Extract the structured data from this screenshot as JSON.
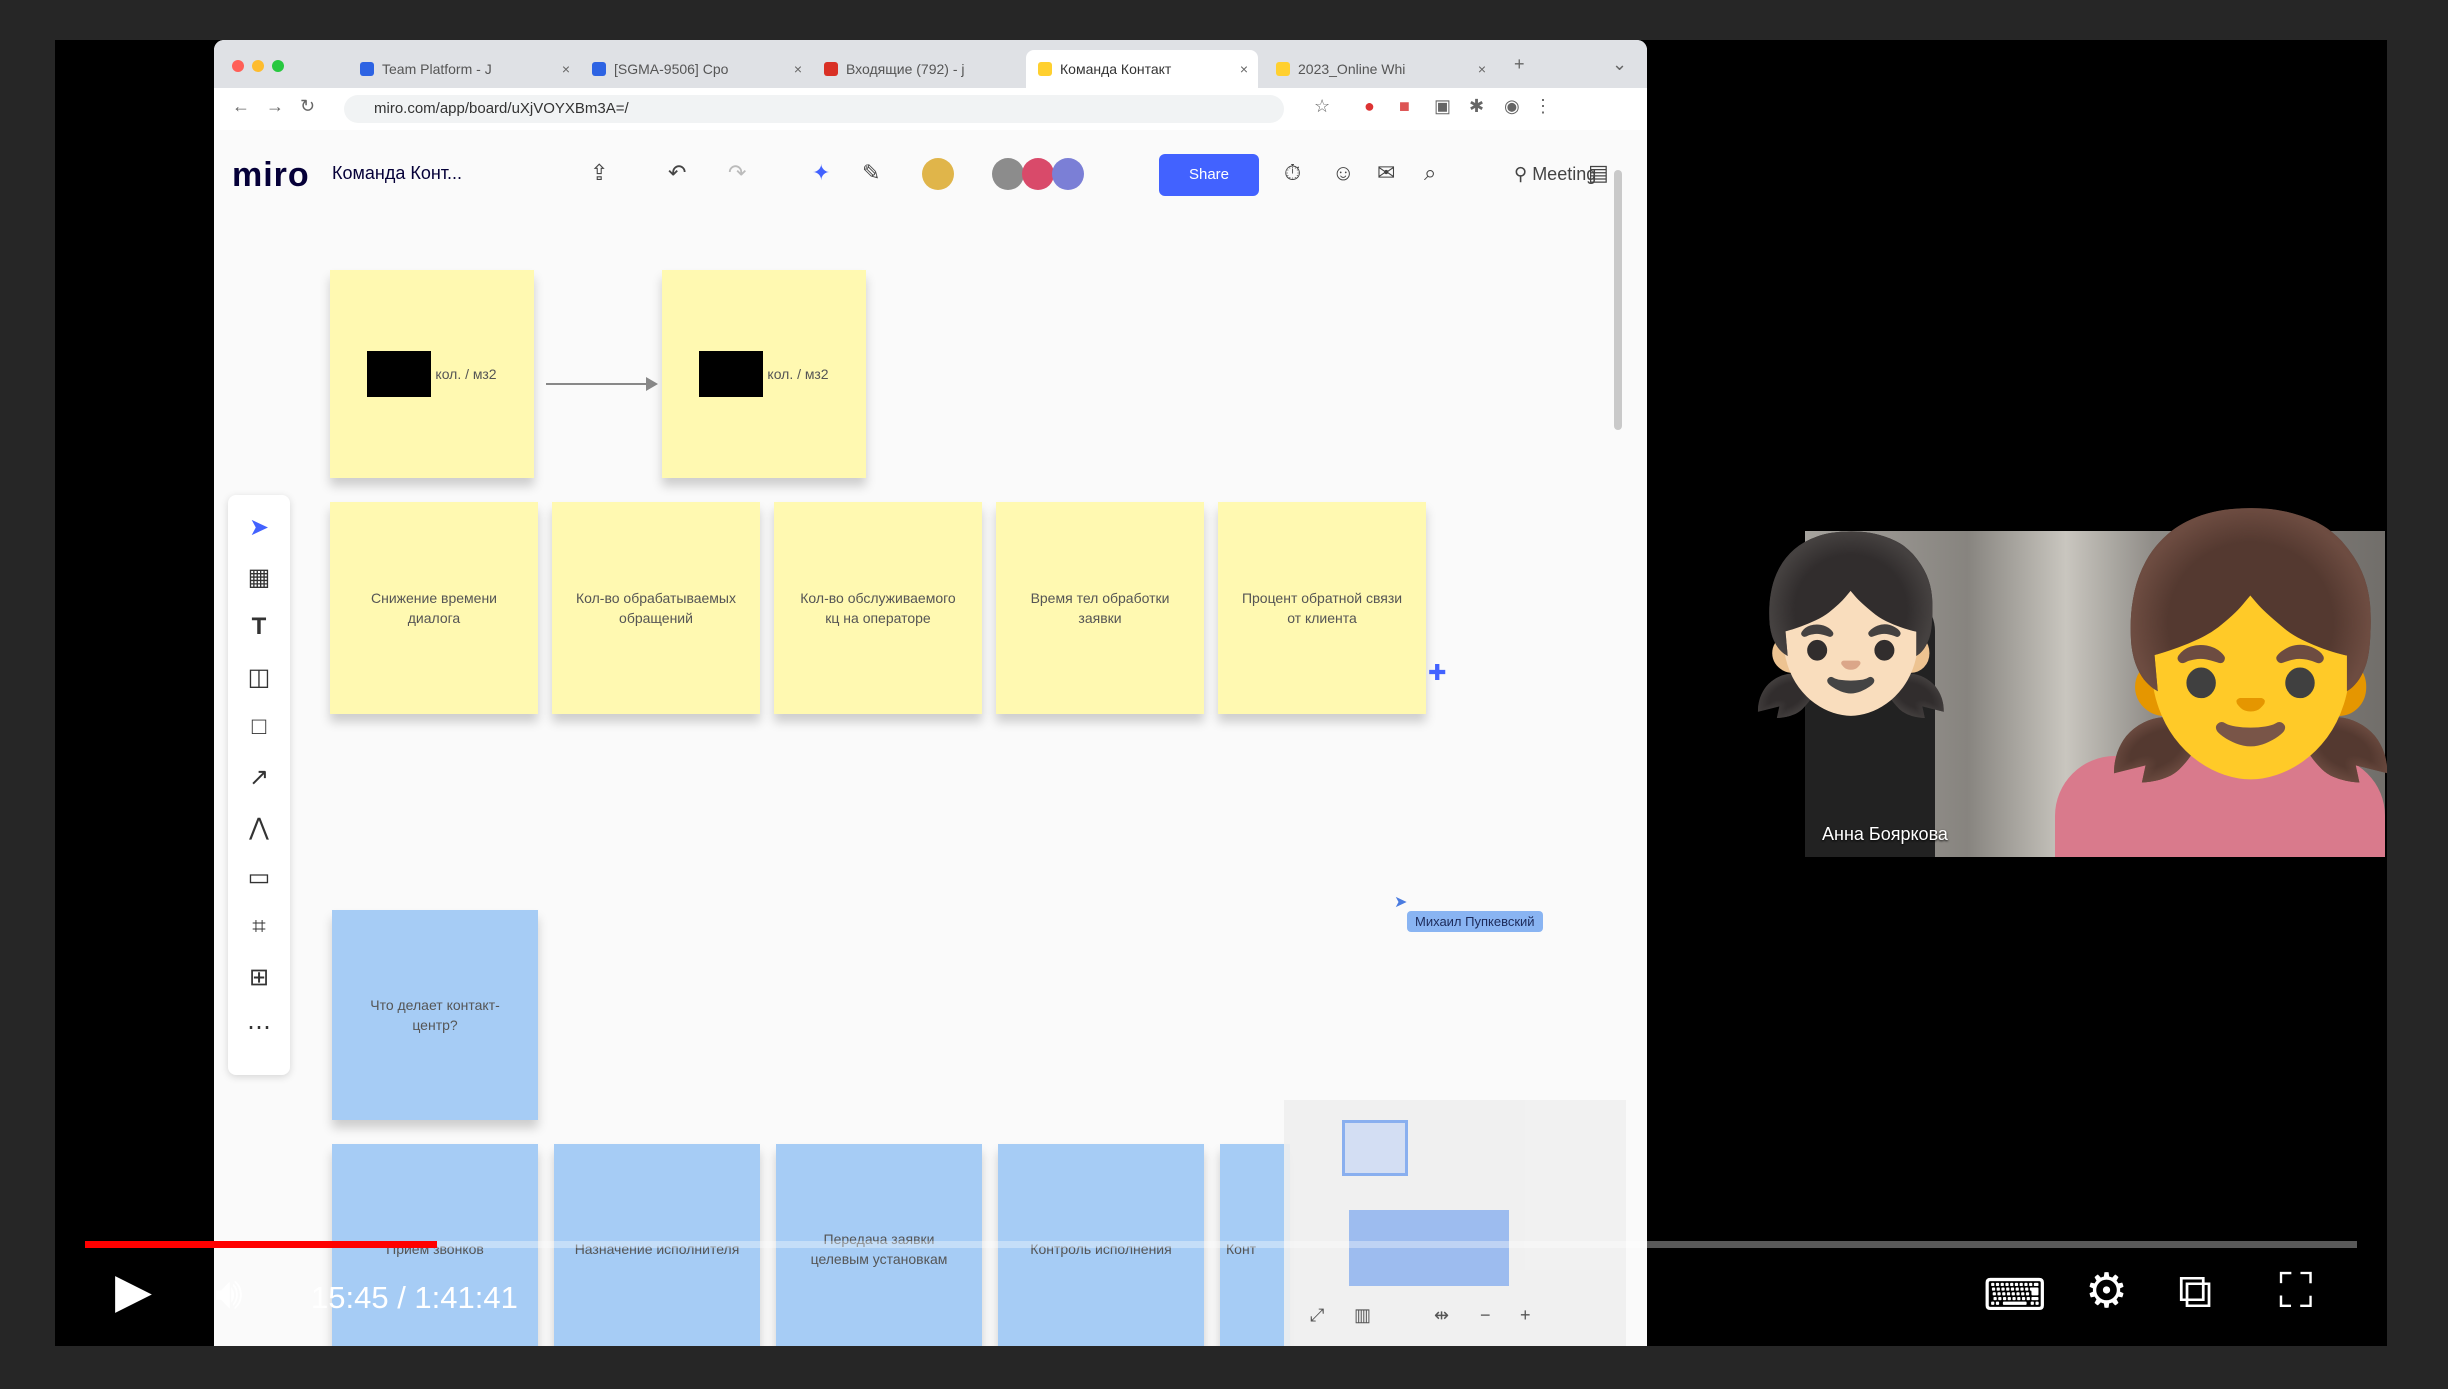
{
  "browser": {
    "tabs": [
      {
        "label": "Team Platform - J",
        "active": false
      },
      {
        "label": "[SGMA-9506] Cpo",
        "active": false
      },
      {
        "label": "Входящие (792) - j",
        "active": false
      },
      {
        "label": "Команда Контакт",
        "active": true
      },
      {
        "label": "2023_Online Whi",
        "active": false
      }
    ],
    "url": "miro.com/app/board/uXjVOYXBm3A=/"
  },
  "miro": {
    "logo": "miro",
    "board_name": "Команда Конт...",
    "share_label": "Share",
    "meeting_label": "Meeting",
    "avatar_colors": [
      "#8c8c8c",
      "#d94a6a",
      "#7b7fd6"
    ]
  },
  "notes_top": [
    {
      "text": "кол. / мз2"
    },
    {
      "text": "кол. / мз2"
    }
  ],
  "notes_yellow": [
    "Снижение времени диалога",
    "Кол-во обрабатываемых обращений",
    "Кол-во обслуживаемого кц на операторе",
    "Время тел обработки заявки",
    "Процент обратной связи от клиента"
  ],
  "note_blue_main": "Что делает контакт-центр?",
  "notes_blue": [
    "Прием звонков",
    "Назначение исполнителя",
    "Передача заявки целевым установкам",
    "Контроль исполнения",
    "Конт"
  ],
  "cursor_user": "Михаил Пупкевский",
  "webcam": {
    "name": "Анна Бояркова",
    "emoji_left": "👧🏻",
    "emoji_right": "👧"
  },
  "player": {
    "time": "15:45 / 1:41:41",
    "progress": 0.155,
    "accent": "#ff0000"
  }
}
